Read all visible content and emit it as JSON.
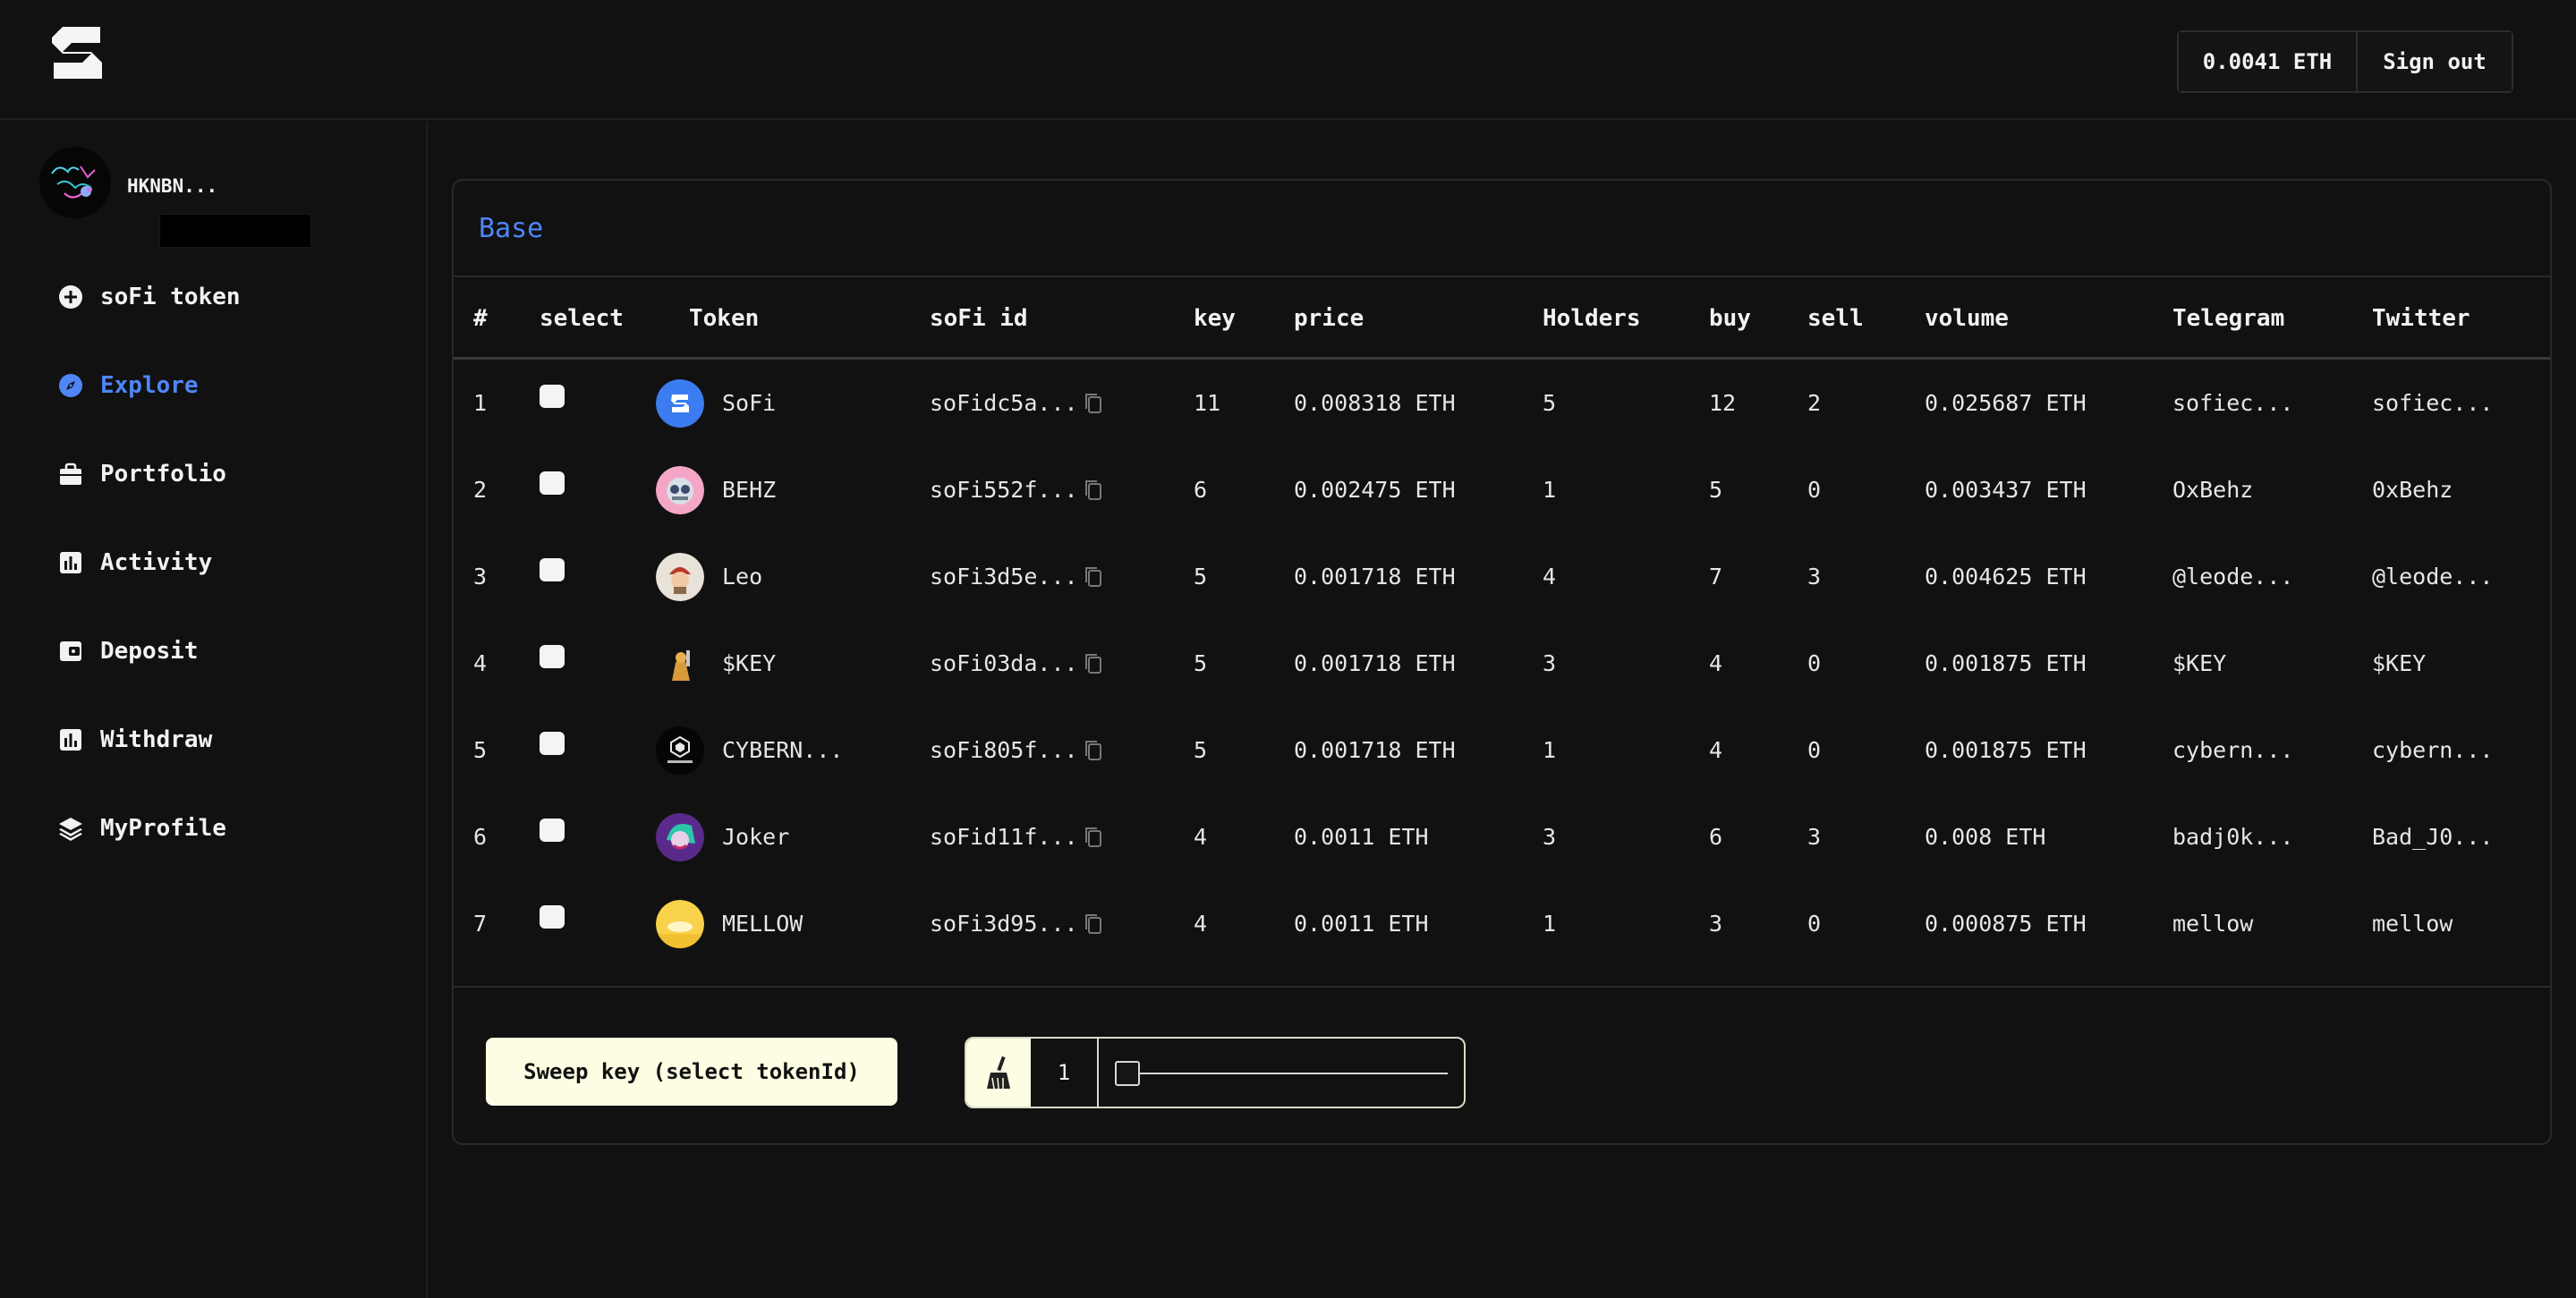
{
  "header": {
    "logo_icon": "sofi-s-logo-icon",
    "balance": "0.0041 ETH",
    "sign_out": "Sign out"
  },
  "profile": {
    "name": "HKNBN..."
  },
  "nav": [
    {
      "label": "soFi token",
      "icon": "plus-circle-icon",
      "active": false
    },
    {
      "label": "Explore",
      "icon": "compass-icon",
      "active": true
    },
    {
      "label": "Portfolio",
      "icon": "briefcase-icon",
      "active": false
    },
    {
      "label": "Activity",
      "icon": "bar-chart-icon",
      "active": false
    },
    {
      "label": "Deposit",
      "icon": "wallet-icon",
      "active": false
    },
    {
      "label": "Withdraw",
      "icon": "bar-chart-icon",
      "active": false
    },
    {
      "label": "MyProfile",
      "icon": "layers-icon",
      "active": false
    }
  ],
  "card": {
    "title": "Base"
  },
  "table": {
    "headers": [
      "#",
      "select",
      "Token",
      "soFi id",
      "key",
      "price",
      "Holders",
      "buy",
      "sell",
      "volume",
      "Telegram",
      "Twitter"
    ],
    "rows": [
      {
        "num": "1",
        "token": "SoFi",
        "sofi_id": "soFidc5a...",
        "key": "11",
        "price": "0.008318 ETH",
        "holders": "5",
        "buy": "12",
        "sell": "2",
        "volume": "0.025687 ETH",
        "telegram": "sofiec...",
        "twitter": "sofiec..."
      },
      {
        "num": "2",
        "token": "BEHZ",
        "sofi_id": "soFi552f...",
        "key": "6",
        "price": "0.002475 ETH",
        "holders": "1",
        "buy": "5",
        "sell": "0",
        "volume": "0.003437 ETH",
        "telegram": "OxBehz",
        "twitter": "0xBehz"
      },
      {
        "num": "3",
        "token": "Leo",
        "sofi_id": "soFi3d5e...",
        "key": "5",
        "price": "0.001718 ETH",
        "holders": "4",
        "buy": "7",
        "sell": "3",
        "volume": "0.004625 ETH",
        "telegram": "@leode...",
        "twitter": "@leode..."
      },
      {
        "num": "4",
        "token": "$KEY",
        "sofi_id": "soFi03da...",
        "key": "5",
        "price": "0.001718 ETH",
        "holders": "3",
        "buy": "4",
        "sell": "0",
        "volume": "0.001875 ETH",
        "telegram": "$KEY",
        "twitter": "$KEY"
      },
      {
        "num": "5",
        "token": "CYBERN...",
        "sofi_id": "soFi805f...",
        "key": "5",
        "price": "0.001718 ETH",
        "holders": "1",
        "buy": "4",
        "sell": "0",
        "volume": "0.001875 ETH",
        "telegram": "cybern...",
        "twitter": "cybern..."
      },
      {
        "num": "6",
        "token": "Joker",
        "sofi_id": "soFid11f...",
        "key": "4",
        "price": "0.0011 ETH",
        "holders": "3",
        "buy": "6",
        "sell": "3",
        "volume": "0.008 ETH",
        "telegram": "badj0k...",
        "twitter": "Bad_J0..."
      },
      {
        "num": "7",
        "token": "MELLOW",
        "sofi_id": "soFi3d95...",
        "key": "4",
        "price": "0.0011 ETH",
        "holders": "1",
        "buy": "3",
        "sell": "0",
        "volume": "0.000875 ETH",
        "telegram": "mellow",
        "twitter": "mellow"
      }
    ]
  },
  "sweep": {
    "button_label": "Sweep key (select tokenId)",
    "broom_icon": "broom-icon",
    "quantity": "1",
    "slider_fraction": 0
  },
  "colors": {
    "accent_blue": "#4f86f7",
    "cream": "#fdfde3",
    "background": "#111111"
  }
}
